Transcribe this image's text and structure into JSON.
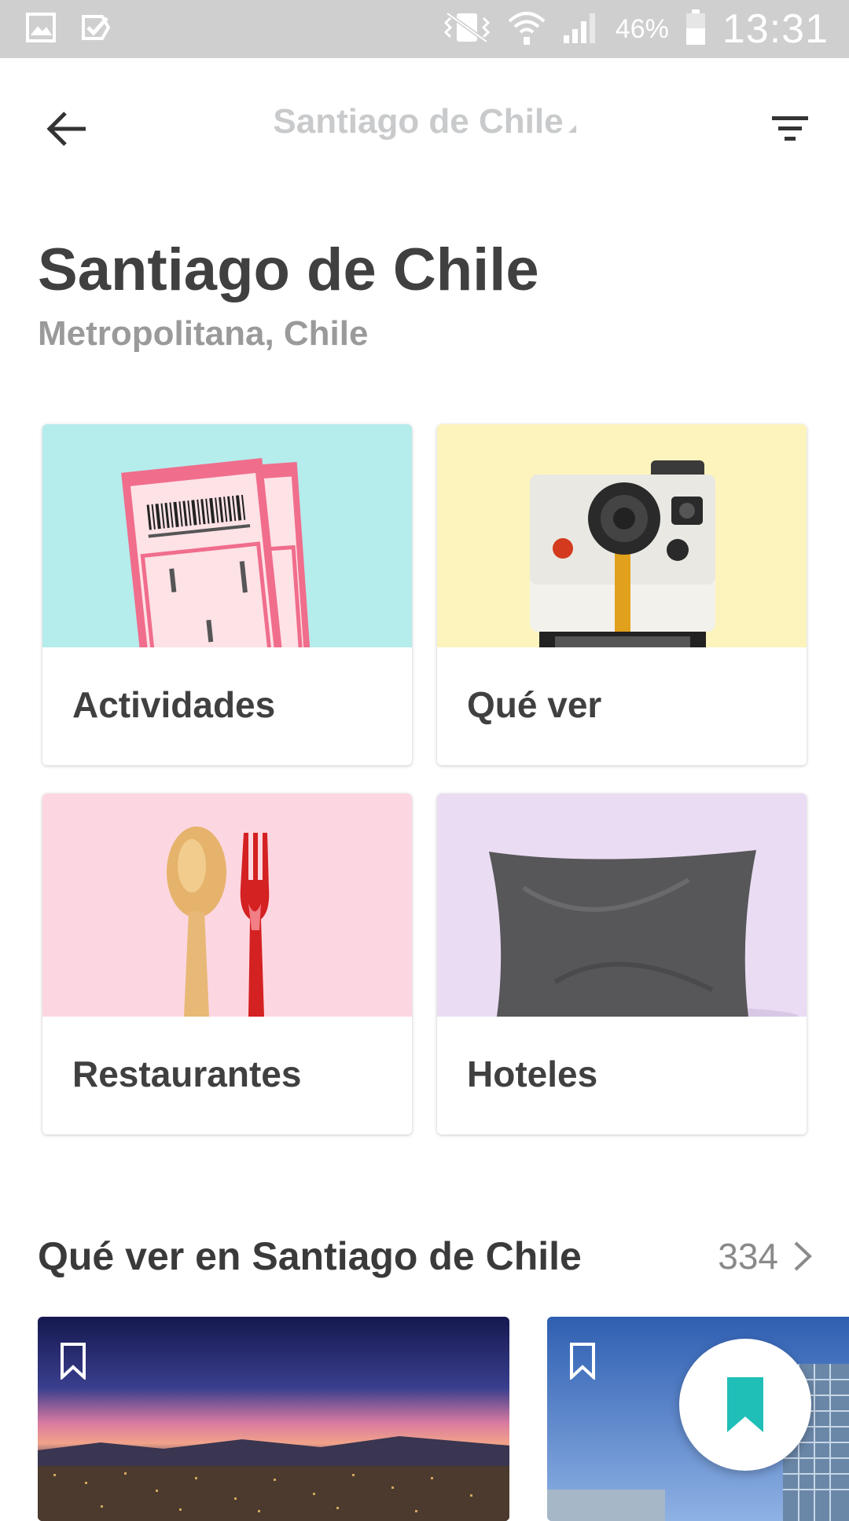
{
  "status_bar": {
    "battery_percent": "46%",
    "time": "13:31",
    "icons": [
      "gallery-icon",
      "check-notification-icon",
      "vibrate-icon",
      "wifi-icon",
      "signal-icon",
      "battery-icon"
    ]
  },
  "app_bar": {
    "title": "Santiago de Chile",
    "back_icon": "arrow-left-icon",
    "filter_icon": "filter-icon"
  },
  "header": {
    "title": "Santiago de Chile",
    "subtitle": "Metropolitana, Chile"
  },
  "categories": [
    {
      "label": "Actividades",
      "bg": "#b5ecec",
      "icon": "tickets-image"
    },
    {
      "label": "Qué ver",
      "bg": "#fdf4bd",
      "icon": "camera-image"
    },
    {
      "label": "Restaurantes",
      "bg": "#fcd7e1",
      "icon": "spoon-fork-image"
    },
    {
      "label": "Hoteles",
      "bg": "#e9dcf3",
      "icon": "pillow-image"
    }
  ],
  "section": {
    "title": "Qué ver en Santiago de Chile",
    "count": "334"
  },
  "places": [
    {
      "icon": "bookmark-outline-icon"
    },
    {
      "icon": "bookmark-outline-icon"
    }
  ],
  "fab": {
    "icon": "bookmark-icon",
    "color": "#1fbfb8"
  }
}
